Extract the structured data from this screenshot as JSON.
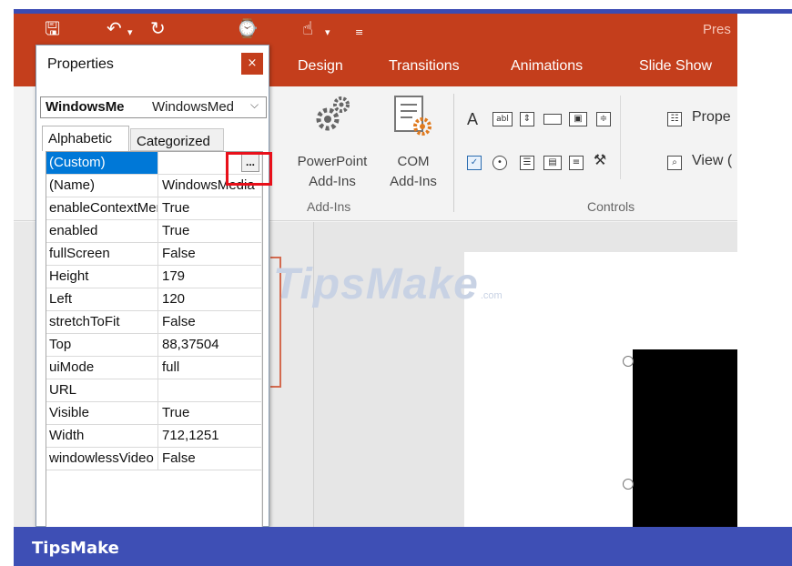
{
  "app": {
    "doc_title": "Pres",
    "qat": {
      "save_glyph": "🖫",
      "undo_glyph": "↶",
      "dropdown_glyph": "▾",
      "redo_glyph": "↻",
      "present_glyph": "⌚",
      "touch_glyph": "☝",
      "customize_glyph": "≡"
    },
    "tabs": [
      "Design",
      "Transitions",
      "Animations",
      "Slide Show"
    ]
  },
  "ribbon": {
    "powerpoint_addins": "PowerPoint\nAdd-Ins",
    "com_addins": "COM\nAdd-Ins",
    "addins_group": "Add-Ins",
    "controls_group": "Controls",
    "properties_label": "Prope",
    "viewcode_label": "View (",
    "label_ctrl_glyph": "A",
    "textbox_ctrl_glyph": "abl"
  },
  "properties_panel": {
    "title": "Properties",
    "close_glyph": "×",
    "object_name": "WindowsMe",
    "object_type": "WindowsMed",
    "combo_chevron": "⌵",
    "tab_alphabetic": "Alphabetic",
    "tab_categorized": "Categorized",
    "ellipsis": "...",
    "rows": [
      {
        "name": "(Custom)",
        "value": ""
      },
      {
        "name": "(Name)",
        "value": "WindowsMedia"
      },
      {
        "name": "enableContextMenu",
        "value": "True"
      },
      {
        "name": "enabled",
        "value": "True"
      },
      {
        "name": "fullScreen",
        "value": "False"
      },
      {
        "name": "Height",
        "value": "179"
      },
      {
        "name": "Left",
        "value": "120"
      },
      {
        "name": "stretchToFit",
        "value": "False"
      },
      {
        "name": "Top",
        "value": "88,37504"
      },
      {
        "name": "uiMode",
        "value": "full"
      },
      {
        "name": "URL",
        "value": ""
      },
      {
        "name": "Visible",
        "value": "True"
      },
      {
        "name": "Width",
        "value": "712,1251"
      },
      {
        "name": "windowlessVideo",
        "value": "False"
      }
    ]
  },
  "watermark": {
    "main": "TipsMake",
    "sub": ".com"
  },
  "footer": {
    "text": "TipsMake"
  },
  "colors": {
    "ppt_accent": "#c43e1c",
    "footer": "#3e4fb5",
    "highlight_box": "#e8101a",
    "selection": "#0078d7"
  }
}
